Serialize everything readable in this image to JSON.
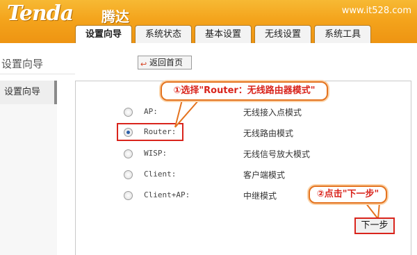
{
  "header": {
    "logo_text": "Tenda",
    "logo_cn": "腾达",
    "watermark": "www.it528.com"
  },
  "tabs": [
    {
      "label": "设置向导",
      "active": true
    },
    {
      "label": "系统状态",
      "active": false
    },
    {
      "label": "基本设置",
      "active": false
    },
    {
      "label": "无线设置",
      "active": false
    },
    {
      "label": "系统工具",
      "active": false
    }
  ],
  "sidebar": {
    "title": "设置向导",
    "items": [
      {
        "label": "设置向导"
      }
    ]
  },
  "home_button": {
    "label": "返回首页",
    "icon": "back-arrow-icon"
  },
  "options": [
    {
      "label": "AP:",
      "desc": "无线接入点模式",
      "checked": false
    },
    {
      "label": "Router:",
      "desc": "无线路由模式",
      "checked": true
    },
    {
      "label": "WISP:",
      "desc": "无线信号放大模式",
      "checked": false
    },
    {
      "label": "Client:",
      "desc": "客户端模式",
      "checked": false
    },
    {
      "label": "Client+AP:",
      "desc": "中继模式",
      "checked": false
    }
  ],
  "annotations": {
    "step1": "①选择\"Router：无线路由器模式\"",
    "step2": "②点击\"下一步\"",
    "accent_color": "#d9241c"
  },
  "next_button": {
    "label": "下一步"
  }
}
